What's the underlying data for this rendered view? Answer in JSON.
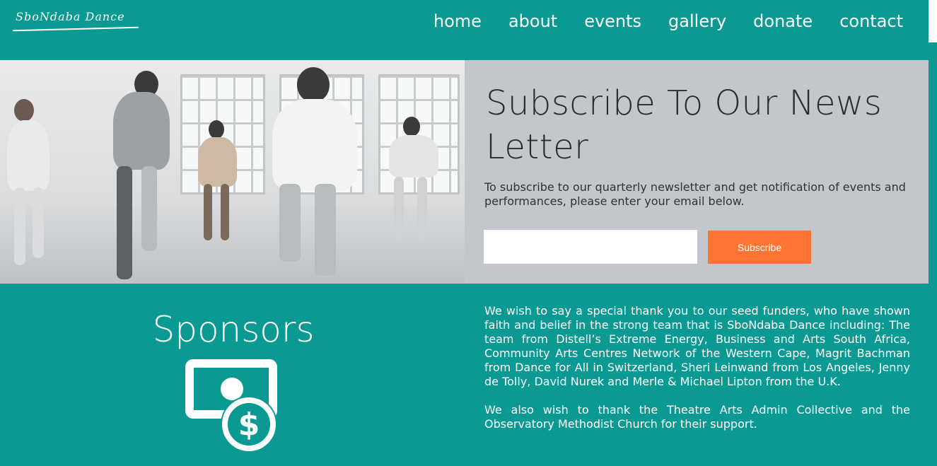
{
  "header": {
    "logo_text": "SboNdaba Dance",
    "nav": [
      "home",
      "about",
      "events",
      "gallery",
      "donate",
      "contact"
    ]
  },
  "newsletter": {
    "title": "Subscribe To Our News Letter",
    "description": "To subscribe to our quarterly newsletter and get notification of events and performances, please enter your email below.",
    "email_value": "",
    "email_placeholder": "",
    "button_label": "Subscribe"
  },
  "sponsors": {
    "title": "Sponsors",
    "icon": "money-dollar-icon",
    "paragraphs": [
      "We wish to say a special thank you to our seed funders, who have shown faith and belief in the strong team that is SboNdaba Dance including: The team from Distell’s Extreme Energy, Business and Arts South Africa, Community Arts Centres Network of the Western Cape, Magrit Bachman from Dance for All in Switzerland, Sheri Leinwand from Los Angeles, Jenny de Tolly, David Nurek and Merle & Michael Lipton from the U.K.",
      "We also wish to thank the Theatre Arts Admin Collective and the Observatory Methodist Church for their support."
    ]
  },
  "colors": {
    "background": "#0b9a93",
    "panel": "#c3c6ca",
    "button": "#fe7434",
    "text_light": "#ffffff",
    "text_dark": "#2b2d2e"
  }
}
